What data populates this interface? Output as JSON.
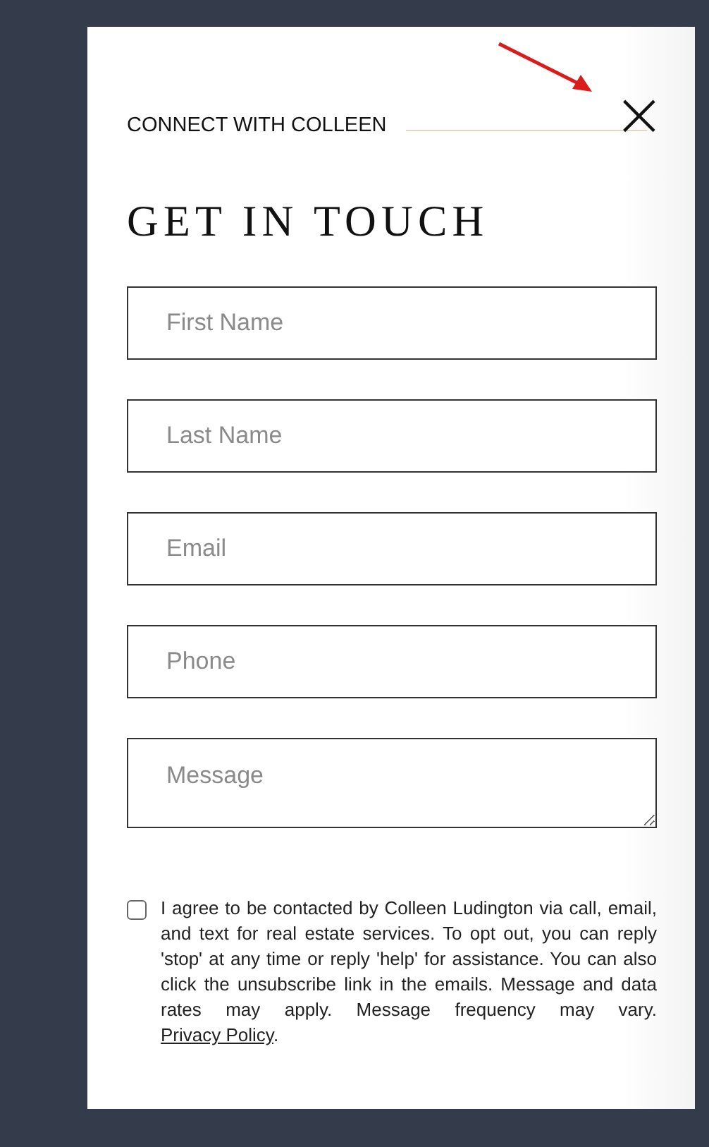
{
  "eyebrow": "CONNECT WITH COLLEEN",
  "close": {
    "glyph": "×"
  },
  "title": "GET IN TOUCH",
  "fields": [
    {
      "placeholder": "First Name",
      "kind": "input"
    },
    {
      "placeholder": "Last Name",
      "kind": "input"
    },
    {
      "placeholder": "Email",
      "kind": "input"
    },
    {
      "placeholder": "Phone",
      "kind": "input"
    },
    {
      "placeholder": "Message",
      "kind": "textarea"
    }
  ],
  "consent": {
    "checked": false,
    "text": "I agree to be contacted by Colleen Ludington via call, email, and text for real estate services. To opt out, you can reply 'stop' at any time or reply 'help' for assistance. You can also click the unsubscribe link in the emails. Message and data rates may apply. Message frequency may vary.",
    "link": "Privacy Policy",
    "trailing": "."
  }
}
